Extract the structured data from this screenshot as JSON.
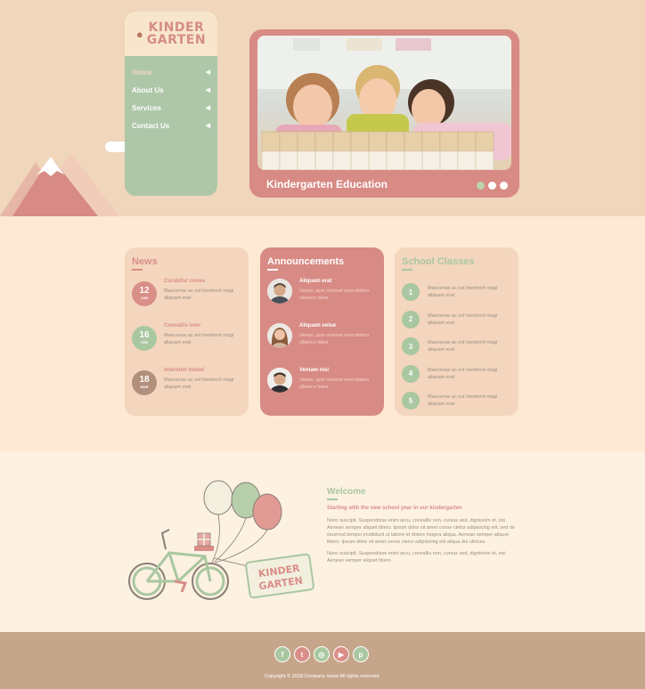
{
  "logo": {
    "line1": "KINDER",
    "line2": "GARTEN"
  },
  "nav": [
    {
      "label": "Home",
      "active": true
    },
    {
      "label": "About Us",
      "active": false
    },
    {
      "label": "Services",
      "active": false
    },
    {
      "label": "Contact Us",
      "active": false
    }
  ],
  "slider": {
    "caption": "Kindergarten Education",
    "dots": 3,
    "active_dot": 2
  },
  "news": {
    "title": "News",
    "items": [
      {
        "day": "12",
        "month": "JAN",
        "title": "Curabitur conva",
        "body": "Maecenas ac est hendrerit magi aliquam erat",
        "color": "#d98e88"
      },
      {
        "day": "16",
        "month": "FEB",
        "title": "Convallis inter",
        "body": "Maecenas ac est hendrerit magi aliquam erat",
        "color": "#a9c7a0"
      },
      {
        "day": "18",
        "month": "MAR",
        "title": "Interdum hedad",
        "body": "Maecenas ac est hendrerit magi aliquam erat",
        "color": "#b18f7b"
      }
    ]
  },
  "announcements": {
    "title": "Announcements",
    "items": [
      {
        "title": "Aliquam erat",
        "body": "Venan, quis nostrud exercitation ullamco labor"
      },
      {
        "title": "Aliquam volue",
        "body": "Venan, quis nostrud exercitation ullamco labor"
      },
      {
        "title": "Veniam nisi",
        "body": "Venan, quis nostrud exercitation ullamco labor"
      }
    ]
  },
  "classes": {
    "title": "School Classes",
    "items": [
      {
        "num": "1",
        "body": "Maecenas ac est hendrerit magi aliquam erat"
      },
      {
        "num": "2",
        "body": "Maecenas ac est hendrerit magi aliquam erat"
      },
      {
        "num": "3",
        "body": "Maecenas ac est hendrerit magi aliquam erat"
      },
      {
        "num": "4",
        "body": "Maecenas ac est hendrerit magi aliquam erat"
      },
      {
        "num": "5",
        "body": "Maecenas ac est hendrerit magi aliquam erat"
      }
    ]
  },
  "welcome": {
    "title": "Welcome",
    "subtitle": "Starting with the new school year in our kindergarten",
    "p1": "Nunc suscipit. Suspendisse enim arcu, convallis non, cursus sed, dignissim et, est. Aenean semper aliquet libero. Ipsum dolor sit amet conse ctetur adipisicing elit, sed do eiusmod tempor incididunt ut labore et dolore magna aliqua. Aenean semper aliquet libero. Ipsum dolor sit amet conse ctetur adipisicing elit aliqua dui ultrices.",
    "p2": "Nunc suscipit. Suspendisse enim arcu, convallis non, cursus sed, dignissim et, est. Aenean semper aliquet libero.",
    "sign_line1": "KINDER",
    "sign_line2": "GARTEN"
  },
  "footer": {
    "socials": [
      {
        "icon": "facebook-icon",
        "glyph": "f",
        "color": "#a9c7a0"
      },
      {
        "icon": "twitter-icon",
        "glyph": "t",
        "color": "#d98e88"
      },
      {
        "icon": "instagram-icon",
        "glyph": "◎",
        "color": "#a9c7a0"
      },
      {
        "icon": "youtube-icon",
        "glyph": "▶",
        "color": "#d98e88"
      },
      {
        "icon": "pinterest-icon",
        "glyph": "p",
        "color": "#a9c7a0"
      }
    ],
    "copyright": "Copyright © 2018.Company name All rights reserved."
  },
  "colors": {
    "pink": "#d88a84",
    "green": "#a9c7a0",
    "peach": "#f0d6bb",
    "brown": "#c6a68a"
  }
}
